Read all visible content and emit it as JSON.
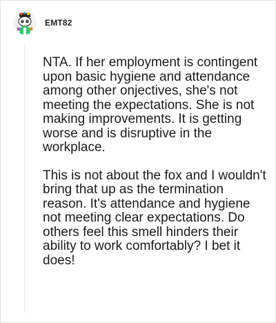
{
  "comment": {
    "username": "EMT82",
    "avatar_icon": "snoo-avatar-icon",
    "paragraphs": [
      "NTA. If her employment is contingent upon basic hygiene and attendance among other onjectives, she's not meeting the expectations. She is not making improvements. It is getting worse and is disruptive in the workplace.",
      "This is not about the fox and I wouldn't bring that up as the termination reason. It's attendance and hygiene not meeting clear expectations. Do others feel this smell hinders their ability to work comfortably? I bet it does!"
    ]
  },
  "colors": {
    "text": "#1a1a1a",
    "username": "#222222",
    "border": "#e2e2e2",
    "thread_line": "#e6e6e6"
  }
}
